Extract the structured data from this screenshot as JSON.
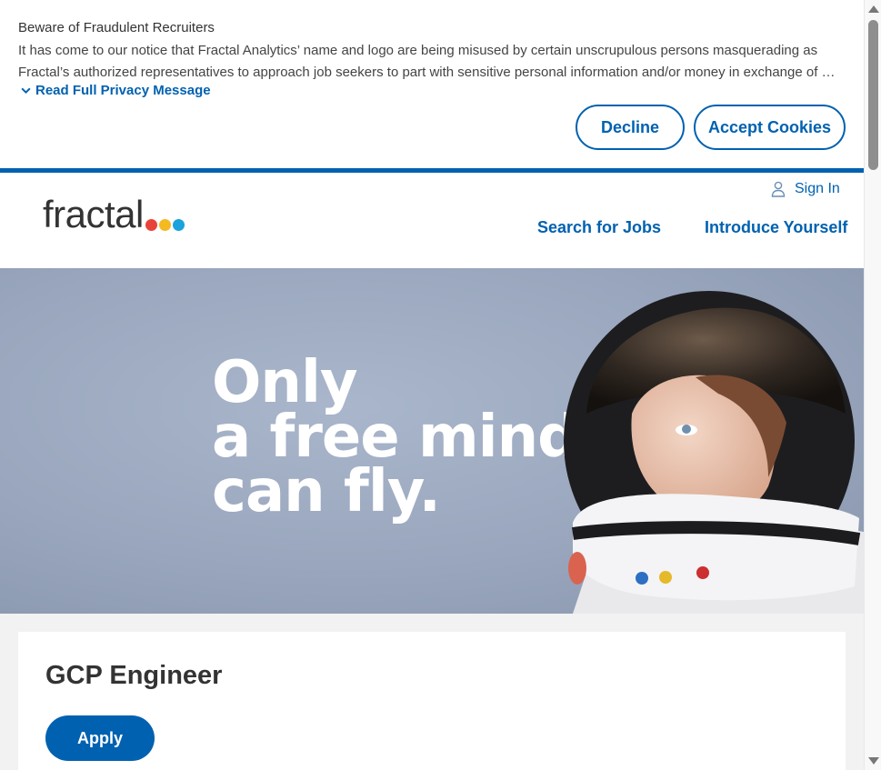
{
  "cookie": {
    "title": "Beware of Fraudulent Recruiters",
    "text_line1": "It has come to our notice that Fractal Analytics’ name and logo are being misused by certain unscrupulous persons masquerading as",
    "text_line2": "Fractal’s authorized representatives to approach job seekers to part with sensitive personal information and/or money in exchange of …",
    "read_more": "Read Full Privacy Message",
    "decline": "Decline",
    "accept": "Accept Cookies"
  },
  "header": {
    "logo_text": "fractal",
    "sign_in": "Sign In",
    "nav": {
      "search_jobs": "Search for Jobs",
      "introduce": "Introduce Yourself"
    }
  },
  "hero": {
    "line1": "Only",
    "line2": "a free mind",
    "line3": "can fly."
  },
  "job": {
    "title": "GCP Engineer",
    "apply": "Apply"
  },
  "colors": {
    "brand_blue": "#0061b0",
    "dot_red": "#e8433a",
    "dot_yellow": "#f5b921",
    "dot_blue": "#1aa3dc"
  },
  "icons": {
    "read_more": "chevron-down-icon",
    "sign_in": "user-icon"
  }
}
